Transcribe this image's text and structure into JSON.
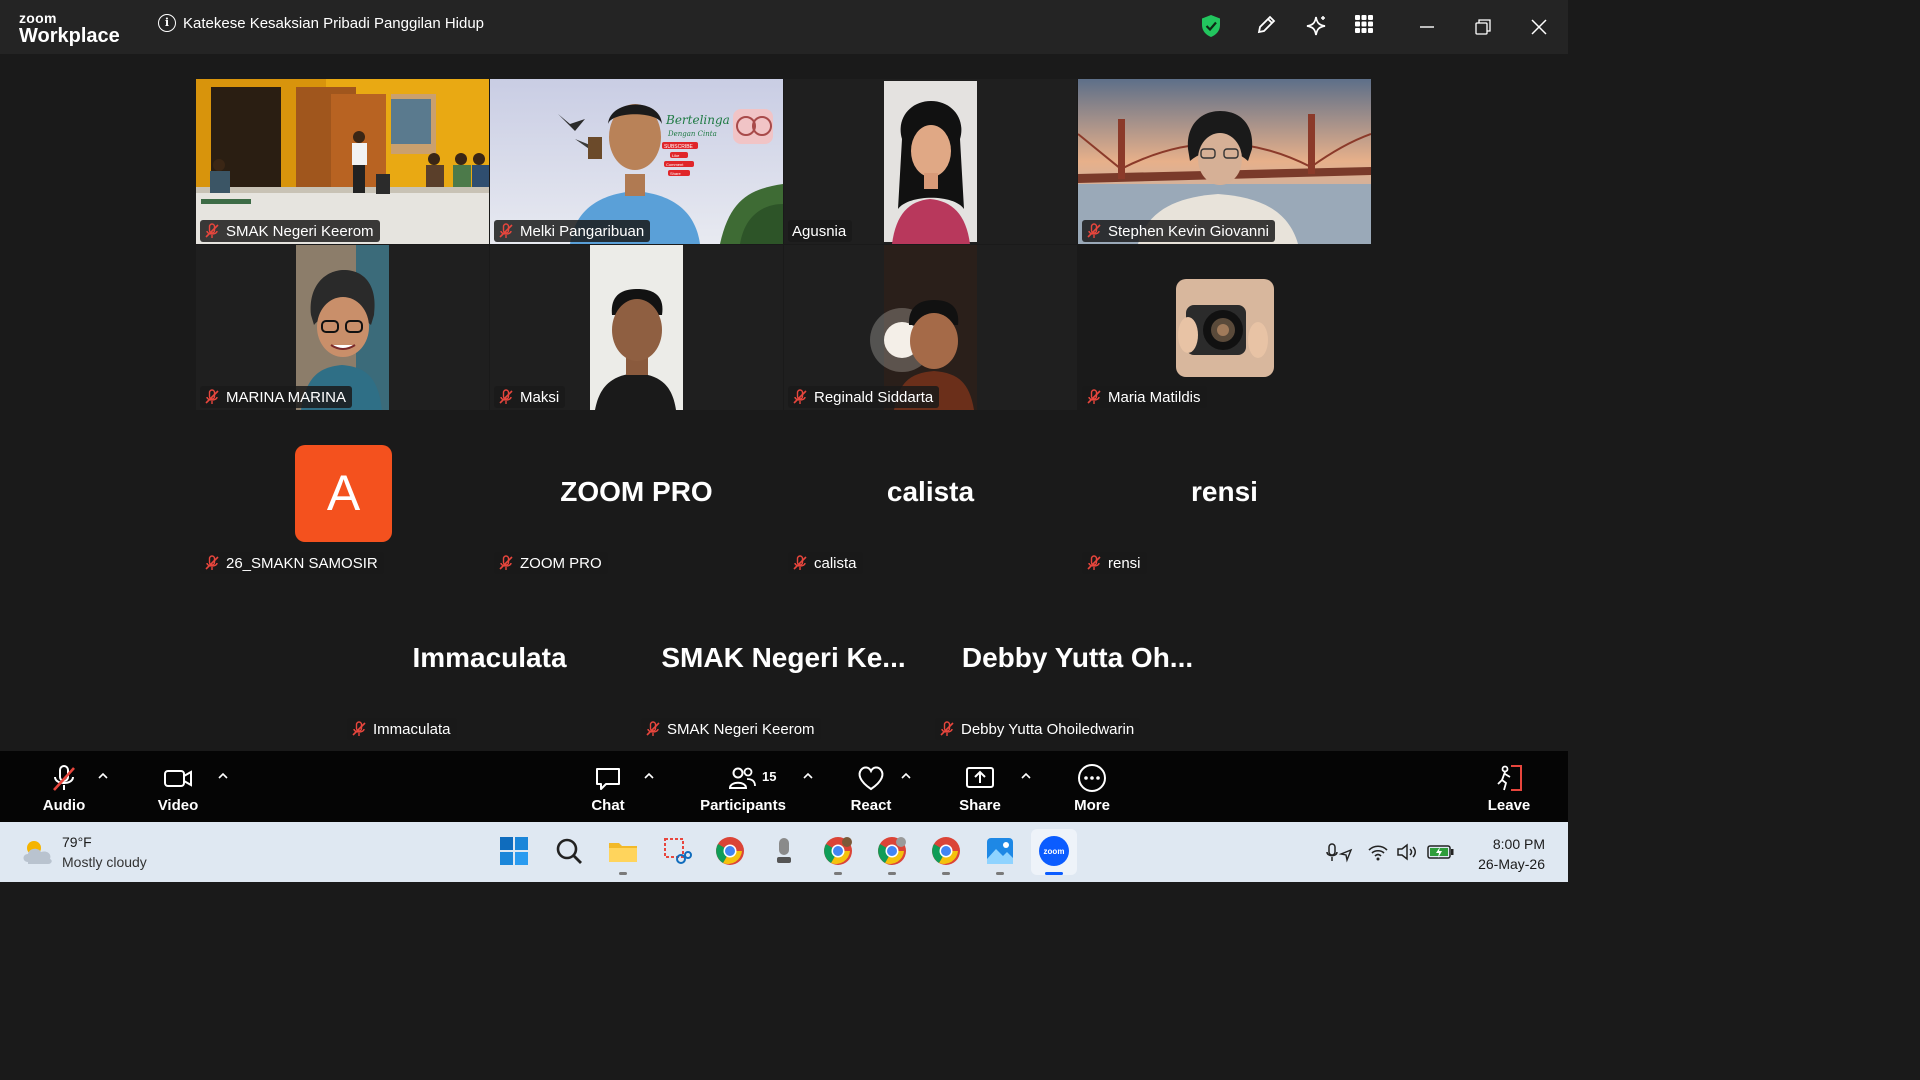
{
  "app": {
    "logo_small": "zoom",
    "logo_large": "Workplace",
    "meeting_title": "Katekese Kesaksian Pribadi Panggilan Hidup"
  },
  "participants_video": [
    {
      "name": "SMAK Negeri Keerom",
      "muted": true
    },
    {
      "name": "Melki Pangaribuan",
      "muted": true
    },
    {
      "name": "Agusnia",
      "muted": false,
      "active_speaker": true
    },
    {
      "name": "Stephen Kevin Giovanni",
      "muted": true
    },
    {
      "name": "MARINA MARINA",
      "muted": true
    },
    {
      "name": "Maksi",
      "muted": true
    },
    {
      "name": "Reginald Siddarta",
      "muted": true
    },
    {
      "name": "Maria Matildis",
      "muted": true
    }
  ],
  "participants_novideo": [
    {
      "display": "A",
      "name": "26_SMAKN SAMOSIR",
      "muted": true
    },
    {
      "display": "ZOOM PRO",
      "name": "ZOOM PRO",
      "muted": true
    },
    {
      "display": "calista",
      "name": "calista",
      "muted": true
    },
    {
      "display": "rensi",
      "name": "rensi",
      "muted": true
    },
    {
      "display": "Immaculata",
      "name": "Immaculata",
      "muted": true
    },
    {
      "display": "SMAK Negeri Ke...",
      "name": "SMAK Negeri Keerom",
      "muted": true
    },
    {
      "display": "Debby Yutta Oh...",
      "name": "Debby Yutta Ohoiledwarin",
      "muted": true
    }
  ],
  "poster_text": {
    "line1": "Bertelinga",
    "line2": "Dengan Cinta",
    "badges": [
      "SUBSCRIBE",
      "Like",
      "Comment",
      "Share"
    ]
  },
  "avatar_color": "#f4511e",
  "toolbar": {
    "audio": "Audio",
    "video": "Video",
    "chat": "Chat",
    "participants": "Participants",
    "participants_count": "15",
    "react": "React",
    "share": "Share",
    "more": "More",
    "leave": "Leave"
  },
  "taskbar": {
    "temperature": "79°F",
    "weather": "Mostly cloudy",
    "time": "8:00 PM",
    "date": "26-May-26"
  }
}
